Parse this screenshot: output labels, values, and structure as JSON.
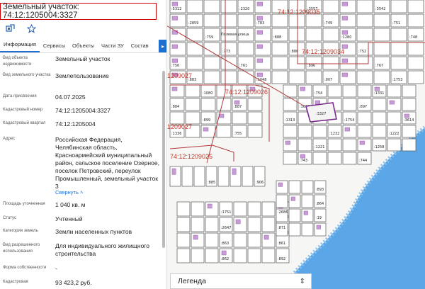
{
  "header": {
    "title": "Земельный участок: 74:12:1205004:3327"
  },
  "toolbar": {
    "zoom_icon": "zoom-to-object-icon",
    "favorite_icon": "star-icon"
  },
  "tabs": [
    {
      "label": "Информация"
    },
    {
      "label": "Сервисы"
    },
    {
      "label": "Объекты"
    },
    {
      "label": "Части ЗУ"
    },
    {
      "label": "Состав"
    }
  ],
  "info": {
    "object_type_label": "Вид объекта недвижимости",
    "object_type": "Земельный участок",
    "land_type_label": "Вид земельного участка",
    "land_type": "Землепользование",
    "assigned_date_label": "Дата присвоения",
    "assigned_date": "04.07.2025",
    "cadastral_number_label": "Кадастровый номер",
    "cadastral_number": "74:12:1205004:3327",
    "cadastral_quarter_label": "Кадастровый квартал",
    "cadastral_quarter": "74:12:1205004",
    "address_label": "Адрес",
    "address": "Российская Федерация, Челябинская область, Красноармейский муниципальный район, сельское поселение Озерное, поселок Петровский, переулок Промышленный, земельный участок 3",
    "collapse_link": "Свернуть",
    "area_label": "Площадь уточненная",
    "area": "1 040 кв. м",
    "status_label": "Статус",
    "status": "Учтенный",
    "category_label": "Категория земель",
    "category": "Земли населенных пунктов",
    "permitted_use_label": "Вид разрешенного использования",
    "permitted_use": "Для индивидуального жилищного строительства",
    "ownership_label": "Форма собственности",
    "ownership": "-",
    "cadastral_value_label": "Кадастровая",
    "cadastral_value": "93 423,2 руб."
  },
  "legend": {
    "label": "Легенда"
  },
  "map": {
    "quarter_labels": [
      "74:12:1209035",
      "74:12:1209026",
      "74:12:1209025",
      "1209027",
      "74:12:1209034"
    ],
    "street_label": "Полевая улица",
    "selected_plot": ":3327",
    "plot_labels": [
      ":5312",
      ":2320",
      ":3557",
      ":3542",
      ":2859",
      ":783",
      ":749",
      ":751",
      ":759",
      ":888",
      ":1280",
      ":748",
      ":773",
      ":880",
      ":752",
      ":756",
      ":761",
      ":896",
      ":767",
      ":883",
      ":1048",
      ":907",
      ":1753",
      ":1080",
      ":884",
      ":887",
      ":899",
      ":1336",
      ":755",
      ":754",
      ":1331",
      ":1620",
      ":897",
      ":1313",
      ":1754",
      ":3614",
      ":1232",
      ":1222",
      ":1221",
      ":1258",
      ":743",
      ":744",
      ":885",
      ":906",
      ":1751",
      ":2686",
      ":2647",
      ":871",
      ":863",
      ":861",
      ":862",
      ":892",
      ":893",
      ":864",
      ":19"
    ]
  },
  "colors": {
    "accent": "#1e6fd0",
    "highlight": "#c00000",
    "building": "#c79bd6",
    "water": "#5aa6e6"
  }
}
